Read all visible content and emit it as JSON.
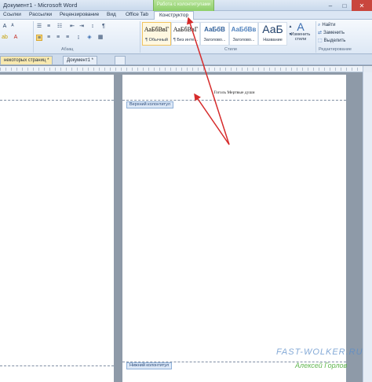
{
  "window": {
    "title": "Документ1 - Microsoft Word",
    "context_tab": "Работа с колонтитулами",
    "controls": [
      "–",
      "□",
      "✕"
    ]
  },
  "tabs": [
    "Ссылки",
    "Рассылки",
    "Рецензирование",
    "Вид",
    "Office Tab",
    "Конструктор"
  ],
  "ribbon": {
    "group_labels": {
      "paragraph": "Абзац",
      "styles": "Стили",
      "editing": "Редактирование"
    },
    "styles": [
      {
        "sample": "АаБбВвГ",
        "name": "¶ Обычный"
      },
      {
        "sample": "АаБбВвГ",
        "name": "¶ Без инте..."
      },
      {
        "sample": "АаБбВ",
        "name": "Заголово..."
      },
      {
        "sample": "АаБбВв",
        "name": "Заголово..."
      },
      {
        "sample": "АаБ",
        "name": "Название"
      }
    ],
    "change_styles": "Изменить стили",
    "editing": {
      "find": "Найти",
      "replace": "Заменить",
      "select": "Выделить"
    }
  },
  "doc_tabs": {
    "first": "некоторых страниц *",
    "second": "Документ1 *"
  },
  "page": {
    "header_text": "Гоголь Мертвые души",
    "header_label": "Верхний колонтитул",
    "footer_label": "Нижний колонтитул"
  },
  "watermark": {
    "site": "FAST-WOLKER.RU",
    "author": "Алексей Горлов"
  },
  "colors": {
    "accent_context_tab": "#8dcf6a",
    "arrow": "#d62b2b",
    "active_doc_tab": "#f8e9b0"
  }
}
